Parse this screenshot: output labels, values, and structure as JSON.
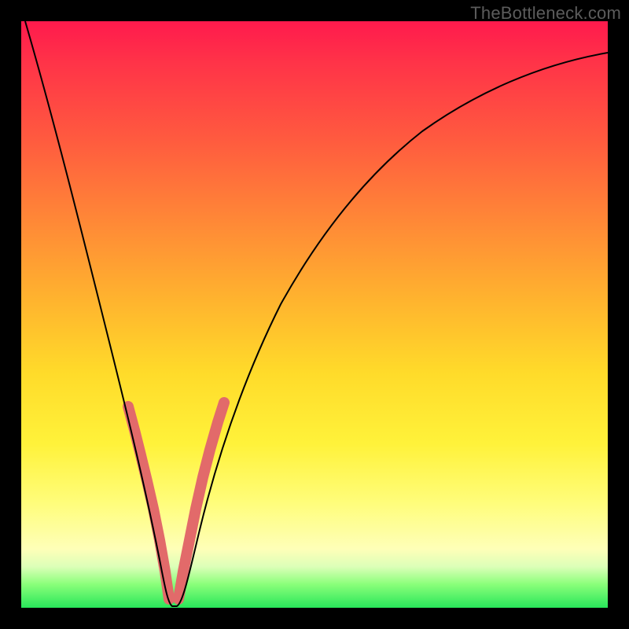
{
  "watermark": "TheBottleneck.com",
  "colors": {
    "frame": "#000000",
    "curve": "#000000",
    "highlight": "#e26a6a",
    "gradient_top": "#ff1a4d",
    "gradient_bottom": "#28e65a"
  },
  "chart_data": {
    "type": "line",
    "title": "",
    "xlabel": "",
    "ylabel": "",
    "xlim": [
      0,
      100
    ],
    "ylim": [
      0,
      100
    ],
    "grid": false,
    "legend": false,
    "description": "Single V-shaped bottleneck curve. Y represents bottleneck severity (0 = ideal match, green; 100 = severe bottleneck, red). Curve minimum near x ≈ 25.",
    "series": [
      {
        "name": "bottleneck-curve",
        "x": [
          0,
          5,
          10,
          15,
          18,
          20,
          22,
          24,
          25,
          26,
          28,
          30,
          33,
          36,
          40,
          45,
          50,
          55,
          60,
          65,
          70,
          75,
          80,
          85,
          90,
          95,
          100
        ],
        "y": [
          100,
          84,
          67,
          48,
          35,
          25,
          14,
          4,
          0,
          3,
          11,
          20,
          31,
          40,
          50,
          60,
          68,
          74,
          79,
          82,
          85,
          87,
          89,
          90,
          91,
          92,
          92
        ]
      }
    ],
    "highlighted_points": {
      "name": "marker-dots",
      "color": "#e26a6a",
      "x": [
        18,
        19,
        20,
        21,
        22,
        23,
        24,
        25,
        26,
        27,
        28,
        29,
        30,
        31,
        32,
        33
      ],
      "y": [
        35,
        30,
        25,
        19,
        14,
        9,
        4,
        0,
        3,
        7,
        11,
        16,
        20,
        24,
        28,
        31
      ]
    }
  }
}
